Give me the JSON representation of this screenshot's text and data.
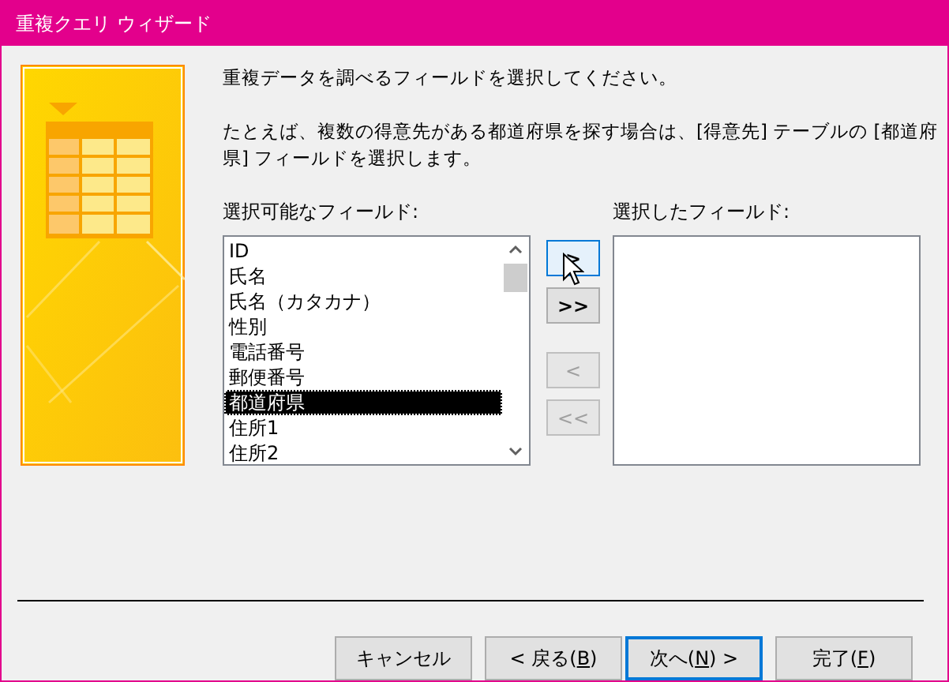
{
  "window": {
    "title": "重複クエリ ウィザード"
  },
  "instructions": [
    "重複データを調べるフィールドを選択してください。",
    "たとえば、複数の得意先がある都道府県を探す場合は、[得意先] テーブルの [都道府県] フィールドを選択します。"
  ],
  "available_fields": {
    "label": "選択可能なフィールド:",
    "items": [
      {
        "text": "ID",
        "selected": false
      },
      {
        "text": "氏名",
        "selected": false
      },
      {
        "text": "氏名（カタカナ）",
        "selected": false
      },
      {
        "text": "性別",
        "selected": false
      },
      {
        "text": "電話番号",
        "selected": false
      },
      {
        "text": "郵便番号",
        "selected": false
      },
      {
        "text": "都道府県",
        "selected": true
      },
      {
        "text": "住所1",
        "selected": false
      },
      {
        "text": "住所2",
        "selected": false
      }
    ]
  },
  "move_buttons": [
    {
      "label": ">",
      "disabled": false,
      "hovered": true
    },
    {
      "label": ">>",
      "disabled": false,
      "hovered": false
    },
    {
      "label": "<",
      "disabled": true,
      "hovered": false
    },
    {
      "label": "<<",
      "disabled": true,
      "hovered": false
    }
  ],
  "selected_fields": {
    "label": "選択したフィールド:"
  },
  "buttons": [
    {
      "label": "キャンセル",
      "default": false
    },
    {
      "label": "< 戻る(",
      "mnemonic": "B",
      "label_end": ")",
      "default": false
    },
    {
      "label": "次へ(",
      "mnemonic": "N",
      "label_end": ") >",
      "default": true
    },
    {
      "label": "完了(",
      "mnemonic": "F",
      "label_end": ")",
      "default": false
    }
  ]
}
